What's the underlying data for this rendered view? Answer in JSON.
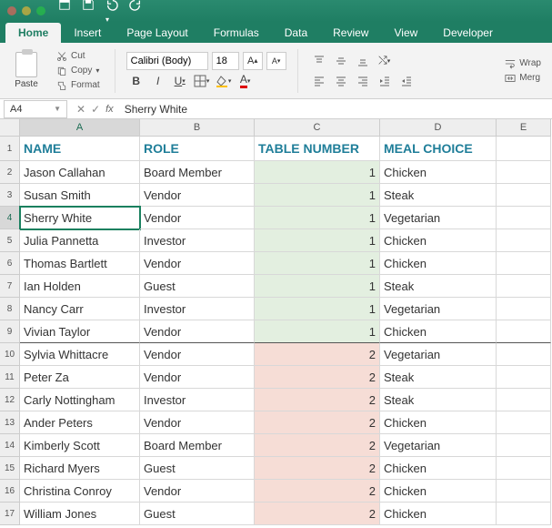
{
  "quickaccess": {
    "icons": [
      "home",
      "save",
      "undo",
      "redo"
    ]
  },
  "tabs": [
    "Home",
    "Insert",
    "Page Layout",
    "Formulas",
    "Data",
    "Review",
    "View",
    "Developer"
  ],
  "activeTab": "Home",
  "ribbon": {
    "paste": "Paste",
    "cut": "Cut",
    "copy": "Copy",
    "format": "Format",
    "font_name": "Calibri (Body)",
    "font_size": "18",
    "wrap": "Wrap",
    "merge": "Merg"
  },
  "formula_bar": {
    "cell_ref": "A4",
    "fx": "fx",
    "value": "Sherry White"
  },
  "columns": [
    "A",
    "B",
    "C",
    "D",
    "E"
  ],
  "headers": {
    "A": "NAME",
    "B": "ROLE",
    "C": "TABLE NUMBER",
    "D": "MEAL CHOICE"
  },
  "selected_col": "A",
  "selected_row": 4,
  "rows": [
    {
      "n": 2,
      "name": "Jason Callahan",
      "role": "Board Member",
      "table": "1",
      "meal": "Chicken",
      "grp": 1
    },
    {
      "n": 3,
      "name": "Susan Smith",
      "role": "Vendor",
      "table": "1",
      "meal": "Steak",
      "grp": 1
    },
    {
      "n": 4,
      "name": "Sherry White",
      "role": "Vendor",
      "table": "1",
      "meal": "Vegetarian",
      "grp": 1
    },
    {
      "n": 5,
      "name": "Julia Pannetta",
      "role": "Investor",
      "table": "1",
      "meal": "Chicken",
      "grp": 1
    },
    {
      "n": 6,
      "name": "Thomas Bartlett",
      "role": "Vendor",
      "table": "1",
      "meal": "Chicken",
      "grp": 1
    },
    {
      "n": 7,
      "name": "Ian Holden",
      "role": "Guest",
      "table": "1",
      "meal": "Steak",
      "grp": 1
    },
    {
      "n": 8,
      "name": "Nancy Carr",
      "role": "Investor",
      "table": "1",
      "meal": "Vegetarian",
      "grp": 1
    },
    {
      "n": 9,
      "name": "Vivian Taylor",
      "role": "Vendor",
      "table": "1",
      "meal": "Chicken",
      "grp": 1
    },
    {
      "n": 10,
      "name": "Sylvia Whittacre",
      "role": "Vendor",
      "table": "2",
      "meal": "Vegetarian",
      "grp": 2
    },
    {
      "n": 11,
      "name": "Peter Za",
      "role": "Vendor",
      "table": "2",
      "meal": "Steak",
      "grp": 2
    },
    {
      "n": 12,
      "name": "Carly Nottingham",
      "role": "Investor",
      "table": "2",
      "meal": "Steak",
      "grp": 2
    },
    {
      "n": 13,
      "name": "Ander Peters",
      "role": "Vendor",
      "table": "2",
      "meal": "Chicken",
      "grp": 2
    },
    {
      "n": 14,
      "name": "Kimberly Scott",
      "role": "Board Member",
      "table": "2",
      "meal": "Vegetarian",
      "grp": 2
    },
    {
      "n": 15,
      "name": "Richard Myers",
      "role": "Guest",
      "table": "2",
      "meal": "Chicken",
      "grp": 2
    },
    {
      "n": 16,
      "name": "Christina Conroy",
      "role": "Vendor",
      "table": "2",
      "meal": "Chicken",
      "grp": 2
    },
    {
      "n": 17,
      "name": "William Jones",
      "role": "Guest",
      "table": "2",
      "meal": "Chicken",
      "grp": 2
    }
  ],
  "colors": {
    "accent": "#1f7e63",
    "header_text": "#1f7e99",
    "group1": "#e3efe0",
    "group2": "#f6ddd6"
  }
}
